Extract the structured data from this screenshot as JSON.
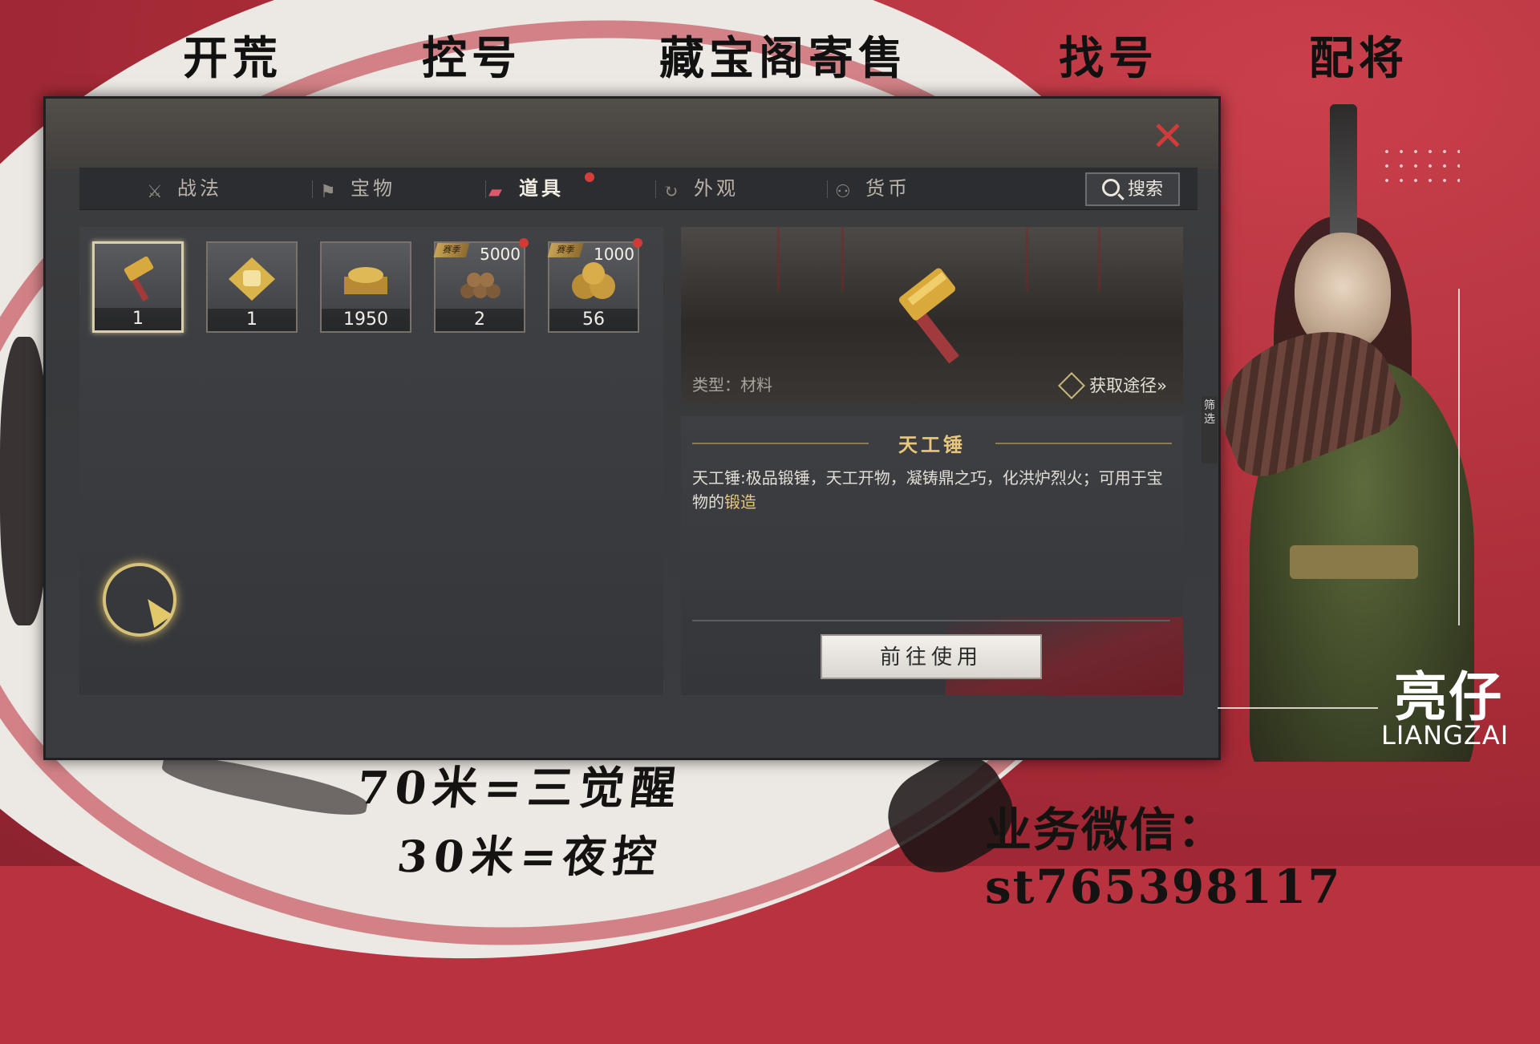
{
  "top_nav": [
    "开荒",
    "控号",
    "藏宝阁寄售",
    "找号",
    "配将"
  ],
  "window": {
    "close_label": "✕",
    "tabs": [
      {
        "label": "战法",
        "icon": "tactics-icon"
      },
      {
        "label": "宝物",
        "icon": "treasure-icon"
      },
      {
        "label": "道具",
        "icon": "item-icon",
        "active": true,
        "badge": true
      },
      {
        "label": "外观",
        "icon": "appearance-icon"
      },
      {
        "label": "货币",
        "icon": "currency-icon"
      }
    ],
    "search_label": "搜索",
    "inventory": [
      {
        "qty": "1",
        "icon": "hammer-icon",
        "selected": true
      },
      {
        "qty": "1",
        "icon": "gold-scroll-icon"
      },
      {
        "qty": "1950",
        "icon": "gold-chest-icon"
      },
      {
        "qty": "2",
        "icon": "wood-pile-icon",
        "limit": "5000",
        "tag": "赛季",
        "badge": true
      },
      {
        "qty": "56",
        "icon": "grain-sack-icon",
        "limit": "1000",
        "tag": "赛季",
        "badge": true
      }
    ],
    "detail": {
      "type_label": "类型：材料",
      "get_way_label": "获取途径»",
      "item_name": "天工锤",
      "description": "天工锤:极品锻锤，天工开物，凝铸鼎之巧，化洪炉烈火；可用于宝物的",
      "description_highlight": "锻造",
      "use_button": "前往使用"
    },
    "filter_label": "筛选"
  },
  "signature": {
    "cn": "亮仔",
    "en": "LIANGZAI"
  },
  "ads": {
    "line1": "70米=三觉醒",
    "line2": "30米=夜控",
    "contact": "业务微信：st765398117"
  },
  "colors": {
    "accent_red": "#d23b3b",
    "gold": "#e8c77b",
    "bg_red": "#b8323f"
  }
}
